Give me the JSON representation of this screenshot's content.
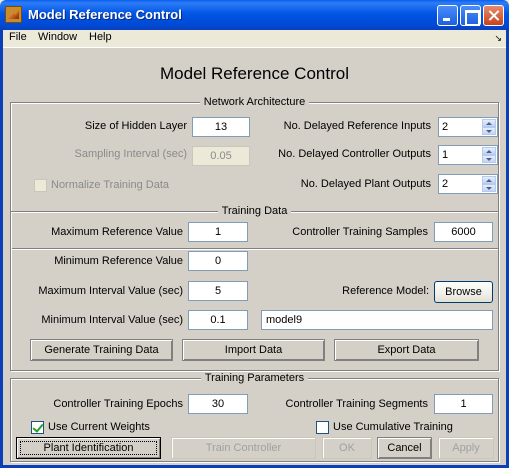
{
  "window": {
    "title": "Model Reference Control"
  },
  "menu": {
    "file": "File",
    "window": "Window",
    "help": "Help",
    "dock_icon": "dock-arrow-icon"
  },
  "heading": "Model Reference Control",
  "network_architecture": {
    "title": "Network Architecture",
    "hidden_layer_label": "Size of Hidden Layer",
    "hidden_layer_value": "13",
    "sampling_label": "Sampling Interval (sec)",
    "sampling_value": "0.05",
    "normalize_label": "Normalize Training Data",
    "normalize_checked": false,
    "ref_inputs_label": "No. Delayed Reference Inputs",
    "ref_inputs_value": "2",
    "ctrl_outputs_label": "No. Delayed Controller Outputs",
    "ctrl_outputs_value": "1",
    "plant_outputs_label": "No. Delayed Plant Outputs",
    "plant_outputs_value": "2"
  },
  "training_data": {
    "title": "Training Data",
    "max_ref_label": "Maximum Reference Value",
    "max_ref_value": "1",
    "min_ref_label": "Minimum Reference Value",
    "min_ref_value": "0",
    "max_int_label": "Maximum Interval Value (sec)",
    "max_int_value": "5",
    "min_int_label": "Minimum Interval Value (sec)",
    "min_int_value": "0.1",
    "samples_label": "Controller Training Samples",
    "samples_value": "6000",
    "ref_model_label": "Reference Model:",
    "browse_label": "Browse",
    "model_value": "model9",
    "generate_label": "Generate Training Data",
    "import_label": "Import Data",
    "export_label": "Export Data"
  },
  "training_params": {
    "title": "Training Parameters",
    "epochs_label": "Controller Training Epochs",
    "epochs_value": "30",
    "segments_label": "Controller Training Segments",
    "segments_value": "1",
    "use_current_label": "Use Current Weights",
    "use_current_checked": true,
    "cumulative_label": "Use Cumulative Training",
    "cumulative_checked": false
  },
  "buttons": {
    "plant_id": "Plant Identification",
    "train": "Train Controller",
    "ok": "OK",
    "cancel": "Cancel",
    "apply": "Apply"
  }
}
